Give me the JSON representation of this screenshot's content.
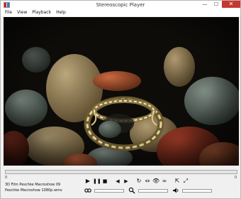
{
  "window": {
    "title": "Stereoscopic Player",
    "minimize_glyph": "—",
    "maximize_glyph": "☐",
    "close_glyph": "✕"
  },
  "menu": {
    "items": [
      "File",
      "View",
      "Playback",
      "Help"
    ]
  },
  "video": {
    "content": "stone-ring-still"
  },
  "seek": {
    "position": 0.0,
    "current_time": "0",
    "end_time": "0"
  },
  "file": {
    "line1": "3D Film Peschke Macroshow 09",
    "line2": "Peschke Macroshow 1080p.wmv"
  },
  "controls": {
    "play": "▶",
    "pause": "❚❚",
    "stop": "■",
    "prev_frame": "◀",
    "next_frame": "▶",
    "loop": "↻",
    "swap": "⇔",
    "view_mode": "👁",
    "anaglyph": "∞",
    "aspect": "⇱",
    "fullscreen": "⤢",
    "stereo_icon": "glasses-icon",
    "zoom_icon": "magnifier-icon",
    "volume_icon": "speaker-icon"
  },
  "sliders": {
    "stereo_level": 0.0,
    "zoom_level": 0.0,
    "volume_level": 0.0
  }
}
